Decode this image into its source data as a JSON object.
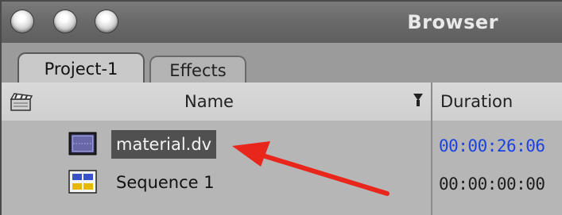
{
  "window": {
    "title": "Browser"
  },
  "tabs": [
    {
      "label": "Project-1",
      "active": true
    },
    {
      "label": "Effects",
      "active": false
    }
  ],
  "columns": {
    "name": "Name",
    "duration": "Duration"
  },
  "rows": [
    {
      "name": "material.dv",
      "icon": "clip-icon",
      "duration": "00:00:26:06",
      "selected": true,
      "duration_color": "#1a43e0"
    },
    {
      "name": "Sequence 1",
      "icon": "sequence-icon",
      "duration": "00:00:00:00",
      "selected": false,
      "duration_color": "#1e1e1e"
    }
  ],
  "annotation": {
    "icon": "red-arrow-icon",
    "color": "#e8261c"
  },
  "colors": {
    "titlebar": "#6a6a6a",
    "selection": "#505050"
  }
}
